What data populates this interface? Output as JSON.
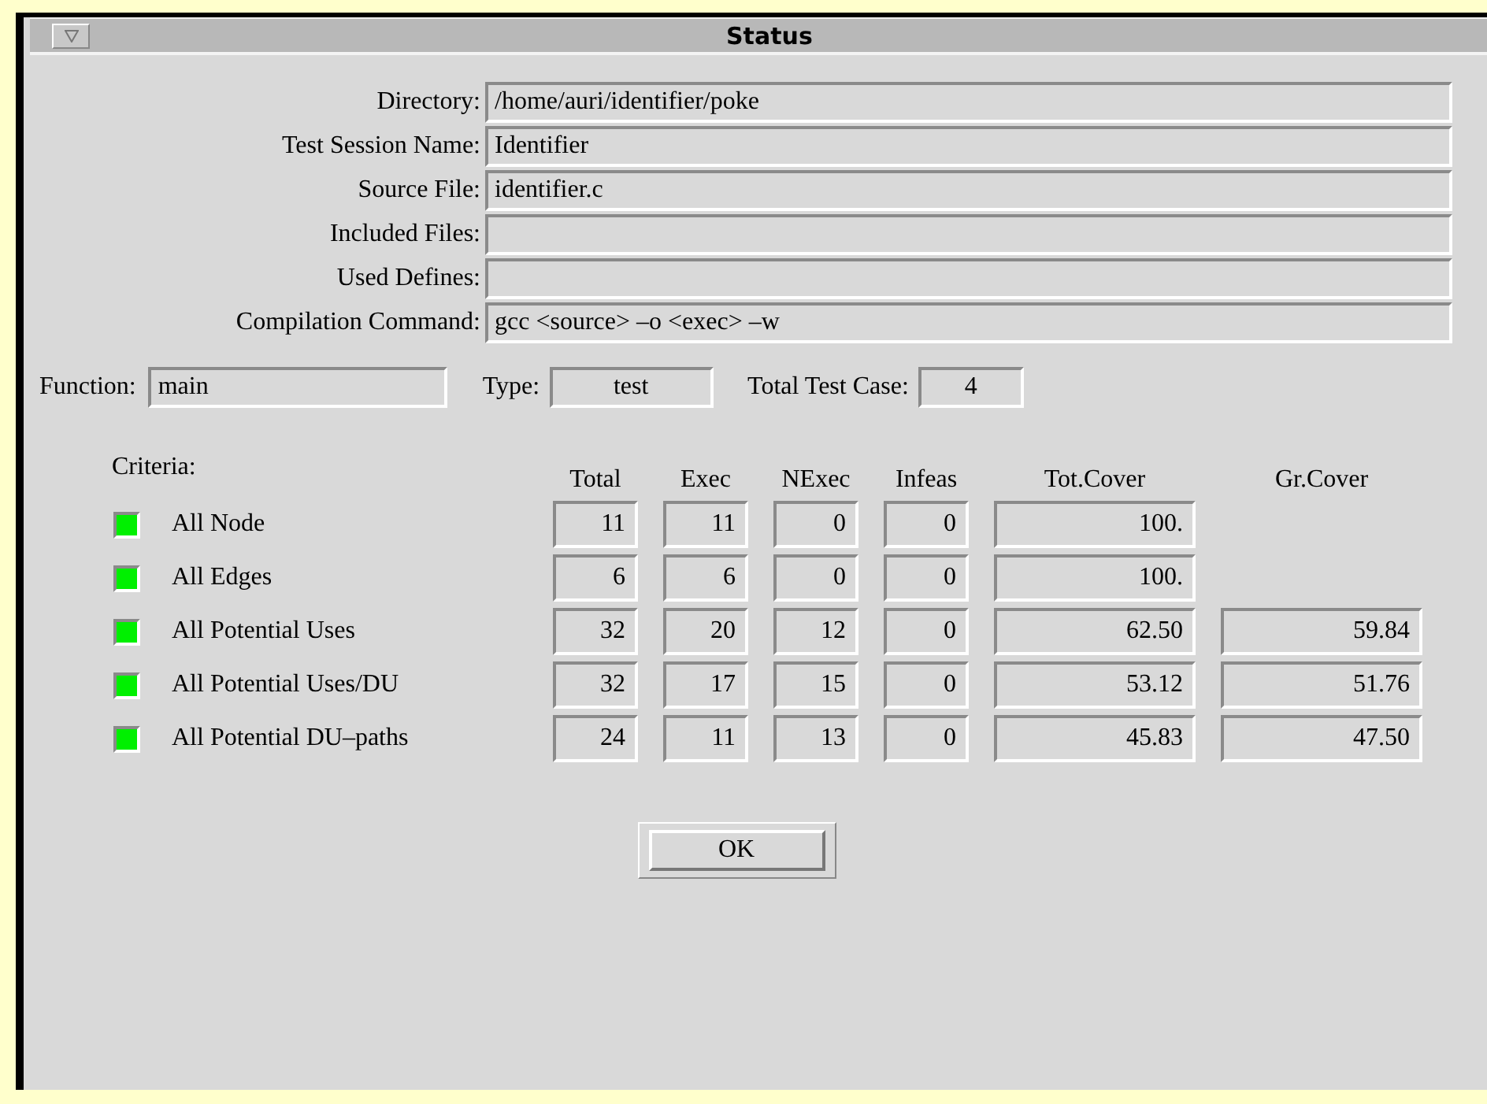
{
  "window": {
    "title": "Status"
  },
  "fields": [
    {
      "label": "Directory:",
      "value": "/home/auri/identifier/poke"
    },
    {
      "label": "Test Session Name:",
      "value": "Identifier"
    },
    {
      "label": "Source File:",
      "value": "identifier.c"
    },
    {
      "label": "Included Files:"
    },
    {
      "label": "Used Defines:"
    },
    {
      "label": "Compilation Command:",
      "value": "gcc <source> –o <exec> –w"
    }
  ],
  "summary": [
    {
      "label": "Function:",
      "value": "main",
      "kind": "wide"
    },
    {
      "label": "Type:",
      "value": "test",
      "kind": "center"
    },
    {
      "label": "Total Test Case:",
      "value": "4",
      "kind": "center"
    }
  ],
  "criteria": {
    "label": "Criteria:",
    "columns": [
      "Total",
      "Exec",
      "NExec",
      "Infeas",
      "Tot.Cover",
      "Gr.Cover"
    ],
    "rows": [
      {
        "name": "All Node",
        "on": true,
        "cells": [
          "11",
          "11",
          "0",
          "0",
          "100."
        ]
      },
      {
        "name": "All Edges",
        "on": true,
        "cells": [
          "6",
          "6",
          "0",
          "0",
          "100."
        ]
      },
      {
        "name": "All Potential Uses",
        "on": true,
        "cells": [
          "32",
          "20",
          "12",
          "0",
          "62.50",
          "59.84"
        ]
      },
      {
        "name": "All Potential Uses/DU",
        "on": true,
        "cells": [
          "32",
          "17",
          "15",
          "0",
          "53.12",
          "51.76"
        ]
      },
      {
        "name": "All Potential DU–paths",
        "on": true,
        "cells": [
          "24",
          "11",
          "13",
          "0",
          "45.83",
          "47.50"
        ]
      }
    ]
  },
  "ok_button": "OK"
}
